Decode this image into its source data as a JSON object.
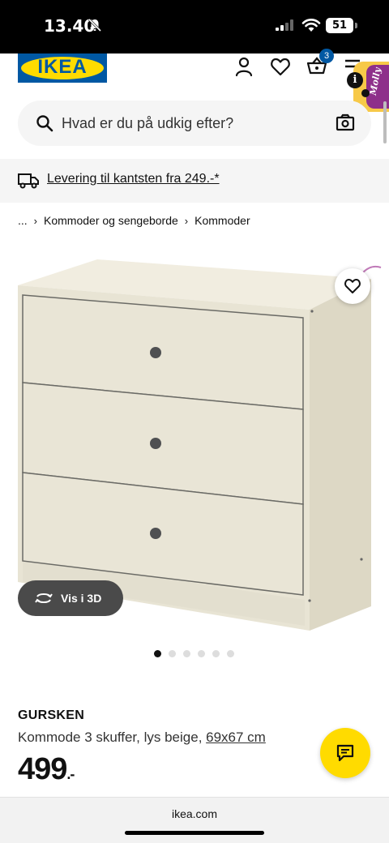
{
  "status_bar": {
    "time": "13.40",
    "battery": "51"
  },
  "header": {
    "logo_text": "IKEA",
    "cart_count": "3",
    "info_badge": "i",
    "assistant_label": "Molly"
  },
  "search": {
    "placeholder": "Hvad er du på udkig efter?"
  },
  "delivery": {
    "text": "Levering til kantsten fra 249.-*"
  },
  "breadcrumb": {
    "ellipsis": "...",
    "items": [
      "Kommoder og sengeborde",
      "Kommoder"
    ]
  },
  "product_image": {
    "view_3d_label": "Vis i 3D",
    "gallery_total": 6,
    "gallery_current": 1
  },
  "product": {
    "name": "GURSKEN",
    "description": "Kommode 3 skuffer, lys beige, ",
    "size": "69x67 cm",
    "price_main": "499",
    "price_suffix": ".-"
  },
  "browser": {
    "url": "ikea.com"
  },
  "colors": {
    "ikea_blue": "#0058a3",
    "ikea_yellow": "#ffdb00",
    "dresser_beige": "#e8e4d4"
  }
}
